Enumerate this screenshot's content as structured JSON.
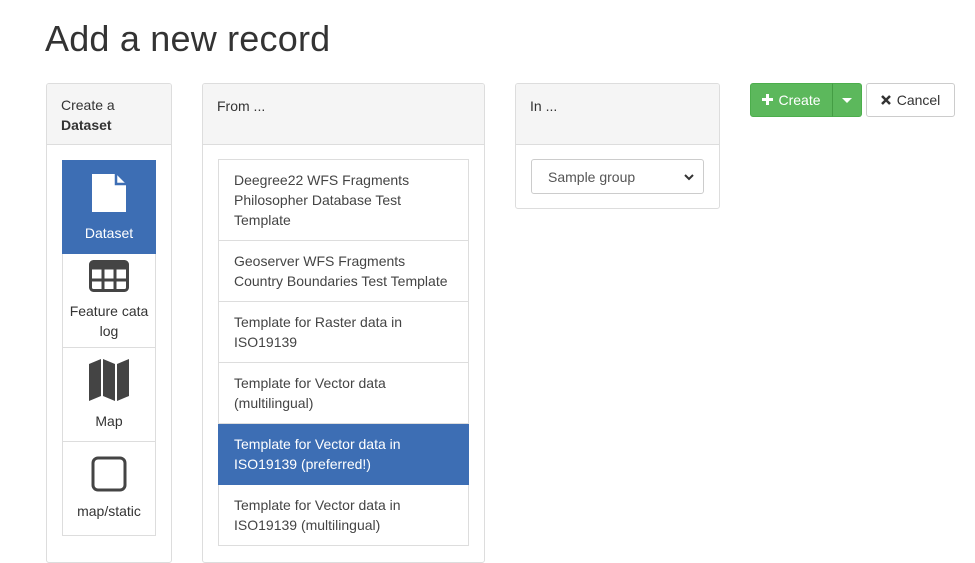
{
  "page": {
    "title": "Add a new record"
  },
  "type_panel": {
    "heading_prefix": "Create a",
    "heading_type": "Dataset",
    "items": [
      {
        "label": "Dataset",
        "icon": "file-icon",
        "active": true
      },
      {
        "label": "Feature catalog",
        "icon": "table-icon",
        "active": false
      },
      {
        "label": "Map",
        "icon": "map-icon",
        "active": false
      },
      {
        "label": "map/static",
        "icon": "square-icon",
        "active": false
      }
    ]
  },
  "from_panel": {
    "heading": "From ...",
    "templates": [
      {
        "label": "Deegree22 WFS Fragments Philosopher Database Test Template",
        "active": false
      },
      {
        "label": "Geoserver WFS Fragments Country Boundaries Test Template",
        "active": false
      },
      {
        "label": "Template for Raster data in ISO19139",
        "active": false
      },
      {
        "label": "Template for Vector data (multilingual)",
        "active": false
      },
      {
        "label": "Template for Vector data in ISO19139 (preferred!)",
        "active": true
      },
      {
        "label": "Template for Vector data in ISO19139 (multilingual)",
        "active": false
      }
    ]
  },
  "in_panel": {
    "heading": "In ...",
    "group_select": {
      "selected": "Sample group"
    }
  },
  "actions": {
    "create_label": "Create",
    "cancel_label": "Cancel",
    "create_color": "#5cb85c",
    "active_color": "#3d6eb4"
  }
}
